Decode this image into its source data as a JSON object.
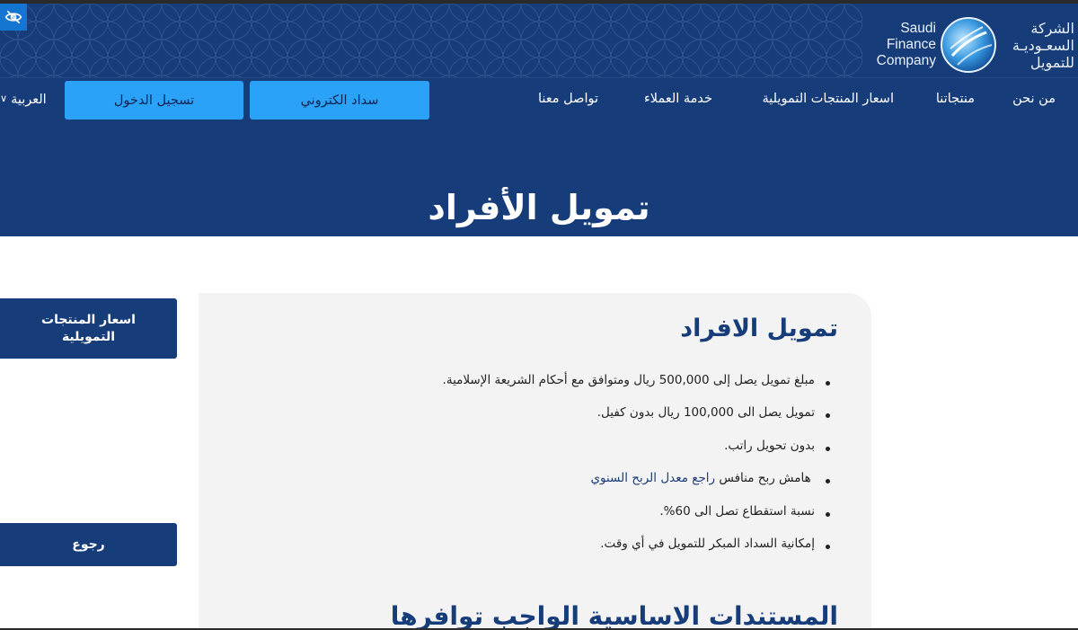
{
  "header": {
    "logo_en": [
      "Saudi",
      "Finance",
      "Company"
    ],
    "logo_ar": [
      "الشركة",
      "السعـوديـة",
      "للتمويل"
    ],
    "nav": {
      "about": "من نحن",
      "products": "منتجاتنا",
      "prices": "اسعار المنتجات التمويلية",
      "customer_service": "خدمة العملاء",
      "contact": "تواصل معنا",
      "epay": "سداد الكتروني",
      "login": "تسجيل الدخول",
      "language": "العربية"
    },
    "accessibility_icon": "eye-slash-icon"
  },
  "hero": {
    "title": "تمويل الأفراد"
  },
  "content": {
    "title": "تمويل الافراد",
    "features": [
      "مبلغ تمويل يصل إلى 500,000 ريال ومتوافق مع أحكام الشريعة الإسلامية.",
      "تمويل يصل الى 100,000 ريال بدون كفيل.",
      "بدون تحويل راتب.",
      "هامش ربح منافس",
      "نسبة استقطاع تصل الى 60%.",
      "إمكانية السداد المبكر للتمويل في أي وقت."
    ],
    "feature_link": "راجع معدل الربح السنوي",
    "subtitle": "المستندات الاساسية الواجب توافرها"
  },
  "sidebar": {
    "prices_button": "اسعار المنتجات التمويلية",
    "back_button": "رجوع"
  },
  "colors": {
    "navy": "#163c79",
    "accent_blue": "#2aa2f8",
    "card_bg": "#f3f3f3"
  }
}
